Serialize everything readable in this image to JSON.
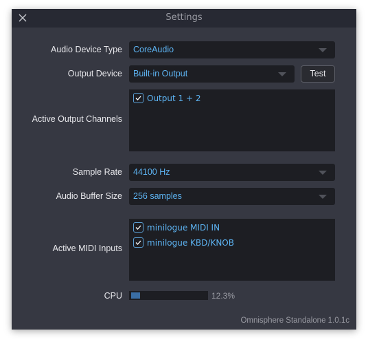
{
  "window": {
    "title": "Settings",
    "close_icon": "close-x-icon"
  },
  "audio_device_type": {
    "label": "Audio Device Type",
    "value": "CoreAudio"
  },
  "output_device": {
    "label": "Output Device",
    "value": "Built-in Output",
    "test_label": "Test"
  },
  "active_output_channels": {
    "label": "Active Output Channels",
    "items": [
      {
        "label": "Output 1 + 2",
        "checked": true
      }
    ]
  },
  "sample_rate": {
    "label": "Sample Rate",
    "value": "44100 Hz"
  },
  "audio_buffer_size": {
    "label": "Audio Buffer Size",
    "value": "256 samples"
  },
  "active_midi_inputs": {
    "label": "Active MIDI Inputs",
    "items": [
      {
        "label": "minilogue MIDI IN",
        "checked": true
      },
      {
        "label": "minilogue KBD/KNOB",
        "checked": true
      }
    ]
  },
  "cpu": {
    "label": "CPU",
    "value_text": "12.3%",
    "percent": 12.3
  },
  "footer": {
    "version": "Omnisphere Standalone 1.0.1c"
  },
  "colors": {
    "accent": "#5db4f3",
    "window_bg": "#363842",
    "titlebar_bg": "#272933",
    "field_bg": "#1d1e23",
    "cpu_fill": "#3a6ea5"
  }
}
